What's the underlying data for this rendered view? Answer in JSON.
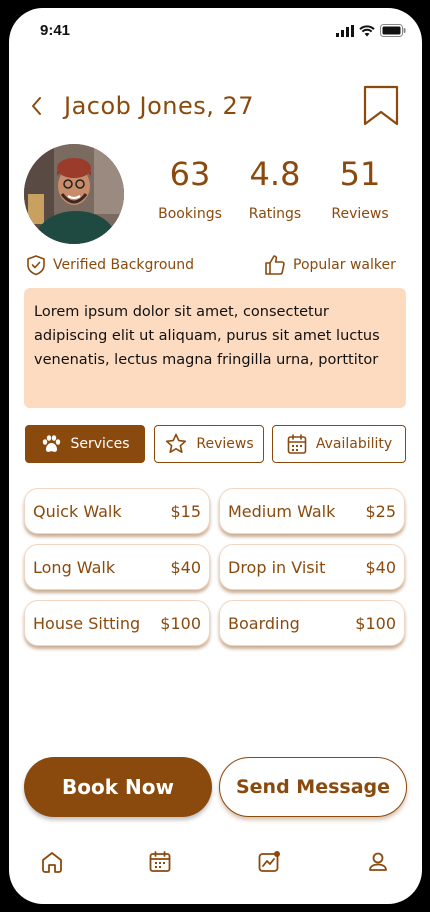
{
  "status_bar": {
    "time": "9:41"
  },
  "header": {
    "title": "Jacob Jones, 27"
  },
  "stats": [
    {
      "value": "63",
      "label": "Bookings"
    },
    {
      "value": "4.8",
      "label": "Ratings"
    },
    {
      "value": "51",
      "label": "Reviews"
    }
  ],
  "badges": {
    "verified": "Verified Background",
    "popular": "Popular walker"
  },
  "bio": "Lorem ipsum dolor sit amet, consectetur adipiscing elit ut aliquam, purus sit amet luctus venenatis, lectus magna fringilla urna, porttitor",
  "tabs": {
    "services": "Services",
    "reviews": "Reviews",
    "availability": "Availability",
    "active": "Services"
  },
  "services": [
    {
      "name": "Quick Walk",
      "price": "$15"
    },
    {
      "name": "Medium Walk",
      "price": "$25"
    },
    {
      "name": "Long Walk",
      "price": "$40"
    },
    {
      "name": "Drop in Visit",
      "price": "$40"
    },
    {
      "name": "House Sitting",
      "price": "$100"
    },
    {
      "name": "Boarding",
      "price": "$100"
    }
  ],
  "actions": {
    "book": "Book Now",
    "message": "Send Message"
  },
  "bottom_nav": [
    "home-icon",
    "calendar-icon",
    "chart-icon",
    "profile-icon"
  ],
  "colors": {
    "accent": "#8a4a0e",
    "bio_bg": "#fddbc1"
  }
}
